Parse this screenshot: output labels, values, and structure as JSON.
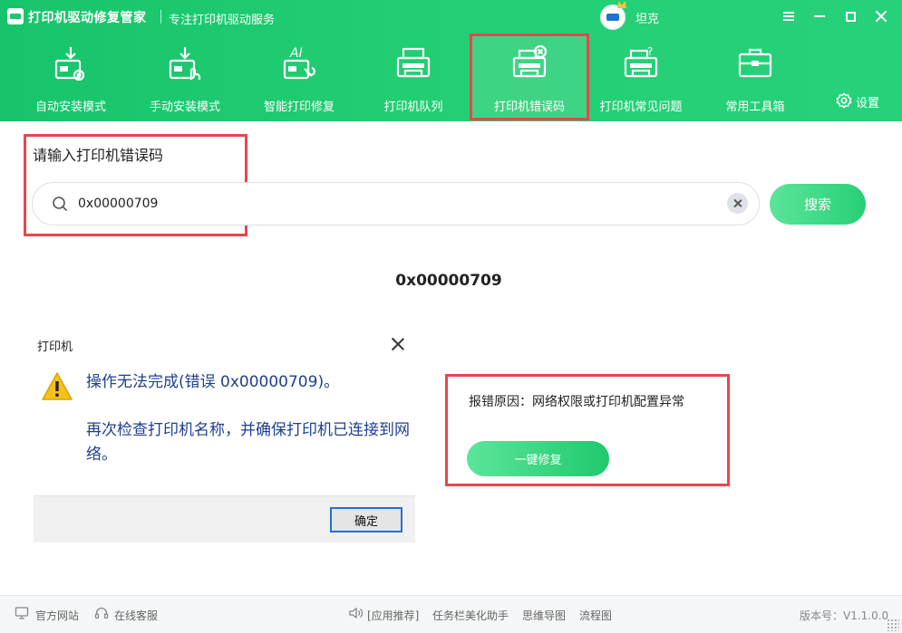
{
  "titlebar": {
    "app_title": "打印机驱动修复管家",
    "subtitle": "专注打印机驱动服务",
    "username": "坦克"
  },
  "nav": {
    "items": [
      {
        "label": "自动安装模式",
        "icon": "auto-install-icon"
      },
      {
        "label": "手动安装模式",
        "icon": "manual-install-icon"
      },
      {
        "label": "智能打印修复",
        "icon": "ai-repair-icon"
      },
      {
        "label": "打印机队列",
        "icon": "printer-queue-icon"
      },
      {
        "label": "打印机错误码",
        "icon": "printer-error-icon",
        "active": true
      },
      {
        "label": "打印机常见问题",
        "icon": "printer-faq-icon"
      },
      {
        "label": "常用工具箱",
        "icon": "toolbox-icon"
      }
    ],
    "settings_label": "设置"
  },
  "search": {
    "label": "请输入打印机错误码",
    "value": "0x00000709",
    "button": "搜索"
  },
  "result": {
    "code": "0x00000709",
    "dialog": {
      "title": "打印机",
      "message": "操作无法完成(错误 0x00000709)。",
      "detail": "再次检查打印机名称，并确保打印机已连接到网络。",
      "ok_label": "确定"
    },
    "reason": "报错原因：网络权限或打印机配置异常",
    "fix_button": "一键修复"
  },
  "footer": {
    "official_site": "官方网站",
    "online_service": "在线客服",
    "recommend_label": "[应用推荐]",
    "apps": [
      "任务栏美化助手",
      "思维导图",
      "流程图"
    ],
    "version": "版本号：V1.1.0.0"
  },
  "colors": {
    "header_green": "#20c96f",
    "highlight_red": "#e8464f",
    "dialog_text_blue": "#1f3f8f"
  }
}
